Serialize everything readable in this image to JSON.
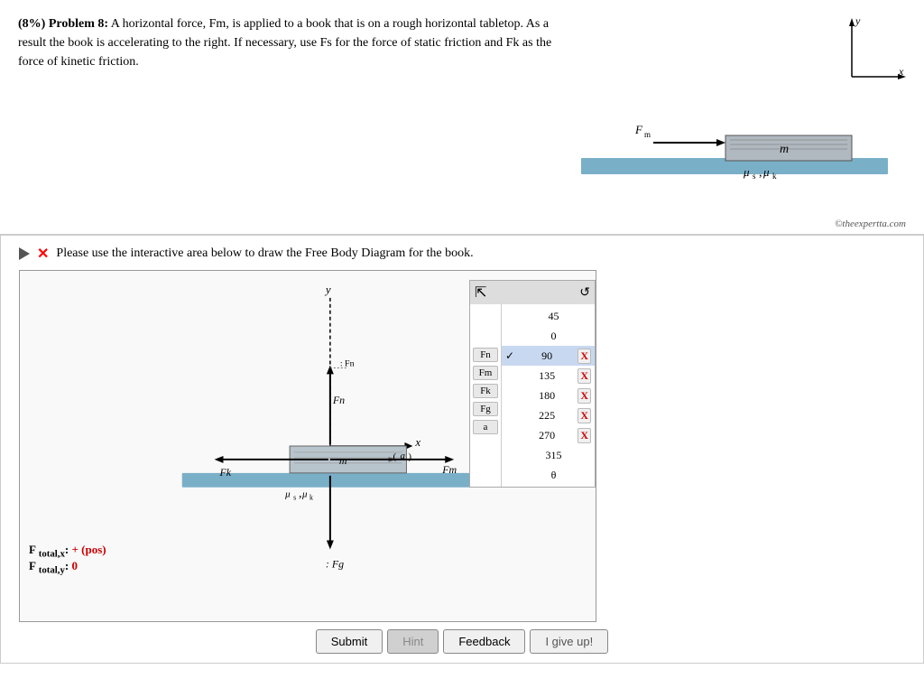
{
  "problem": {
    "percent": "(8%)",
    "label": "Problem 8:",
    "description": "A horizontal force, Fm, is applied to a book that is on a rough horizontal tabletop. As a result the book is accelerating to the right. If necessary, use Fs for the force of static friction and Fk as the force of kinetic friction.",
    "watermark": "©theexpertta.com"
  },
  "interactive": {
    "instruction": "Please use the interactive area below to draw the Free Body Diagram for the book.",
    "totals": {
      "x_label": "F total,x:",
      "x_value": "+ (pos)",
      "y_label": "F total,y:",
      "y_value": "0"
    }
  },
  "angle_panel": {
    "values": [
      {
        "label": "",
        "value": "45",
        "selected": false,
        "has_x": false
      },
      {
        "label": "",
        "value": "0",
        "selected": false,
        "has_x": false
      },
      {
        "label": "Fn",
        "value": "90",
        "selected": true,
        "has_x": true
      },
      {
        "label": "Fm",
        "value": "135",
        "selected": false,
        "has_x": true
      },
      {
        "label": "Fk",
        "value": "180",
        "selected": false,
        "has_x": true
      },
      {
        "label": "Fg",
        "value": "225",
        "selected": false,
        "has_x": true
      },
      {
        "label": "a",
        "value": "270",
        "selected": false,
        "has_x": true
      },
      {
        "label": "",
        "value": "315",
        "selected": false,
        "has_x": false
      },
      {
        "label": "",
        "value": "θ",
        "selected": false,
        "has_x": false
      }
    ]
  },
  "buttons": {
    "submit": "Submit",
    "hint": "Hint",
    "feedback": "Feedback",
    "igiveup": "I give up!"
  }
}
